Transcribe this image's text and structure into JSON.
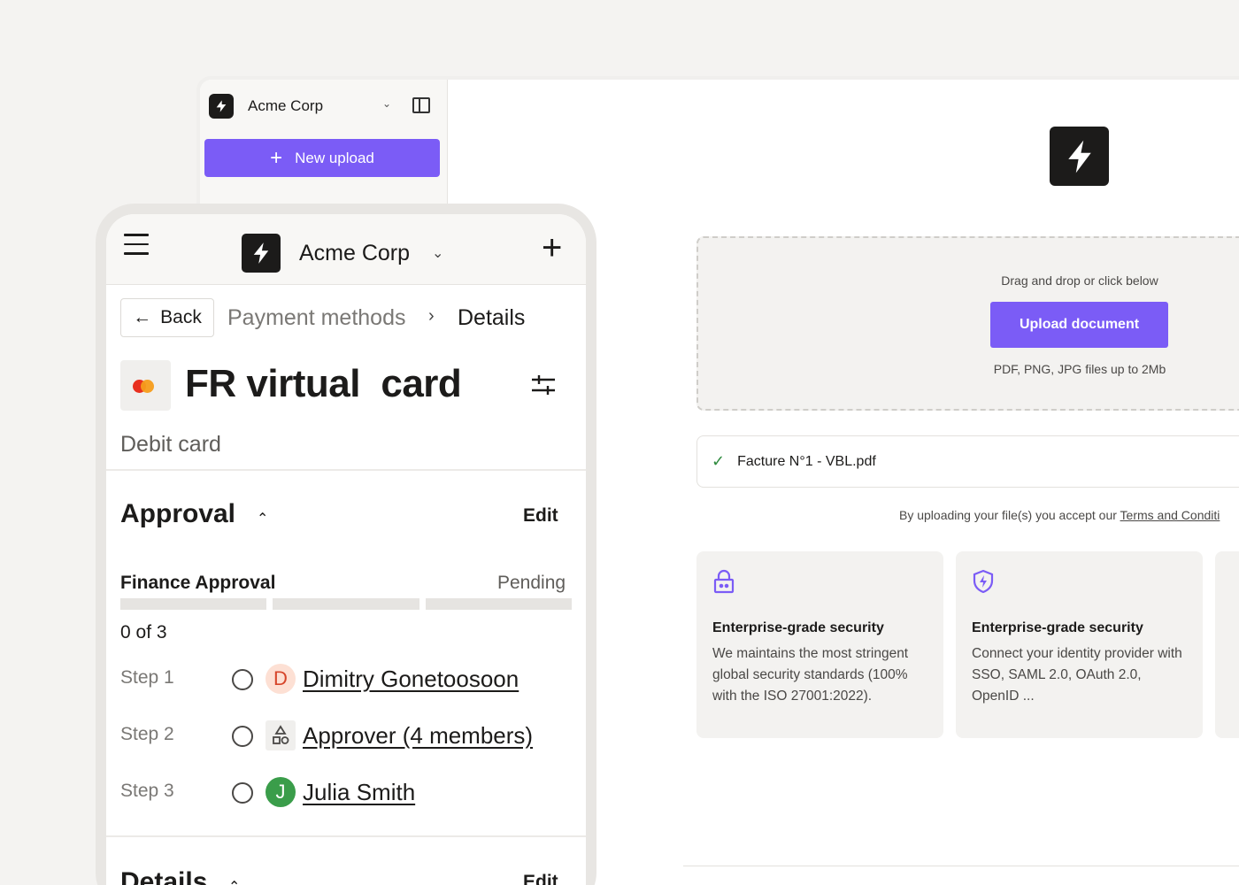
{
  "desktop": {
    "workspace_name": "Acme Corp",
    "new_upload_label": "New upload",
    "dropzone": {
      "hint": "Drag and drop or click below",
      "upload_label": "Upload document",
      "file_types": "PDF, PNG, JPG files up to 2Mb"
    },
    "uploaded_file": "Facture N°1 - VBL.pdf",
    "terms_prefix": "By uploading your file(s) you accept our ",
    "terms_link": "Terms and Conditi",
    "features": [
      {
        "icon": "lock-icon",
        "title": "Enterprise-grade security",
        "body": "We maintains the most stringent global security standards (100% with the ISO 27001:2022)."
      },
      {
        "icon": "shield-bolt-icon",
        "title": "Enterprise-grade security",
        "body": "Connect your identity provider with SSO, SAML 2.0, OAuth 2.0, OpenID ..."
      }
    ]
  },
  "mobile": {
    "workspace_name": "Acme Corp",
    "back_label": "Back",
    "breadcrumb": {
      "parent": "Payment methods",
      "current": "Details"
    },
    "card_title": "FR virtual  card",
    "card_subtitle": "Debit card",
    "approval": {
      "heading": "Approval",
      "edit_label": "Edit",
      "flow_name": "Finance Approval",
      "status": "Pending",
      "progress": {
        "completed": 0,
        "total": 3
      },
      "count_text": "0 of 3",
      "steps": [
        {
          "label": "Step 1",
          "avatar": "D",
          "name": "Dimitry Gonetoosoon",
          "extra": ""
        },
        {
          "label": "Step 2",
          "avatar": "group-icon",
          "name": "Approver",
          "extra": " (4 members)"
        },
        {
          "label": "Step 3",
          "avatar": "J",
          "name": "Julia Smith",
          "extra": ""
        }
      ]
    },
    "details": {
      "heading": "Details",
      "edit_label": "Edit"
    }
  },
  "colors": {
    "accent": "#7b5cf6",
    "dark": "#1c1b1a",
    "success": "#2e8b3e"
  }
}
